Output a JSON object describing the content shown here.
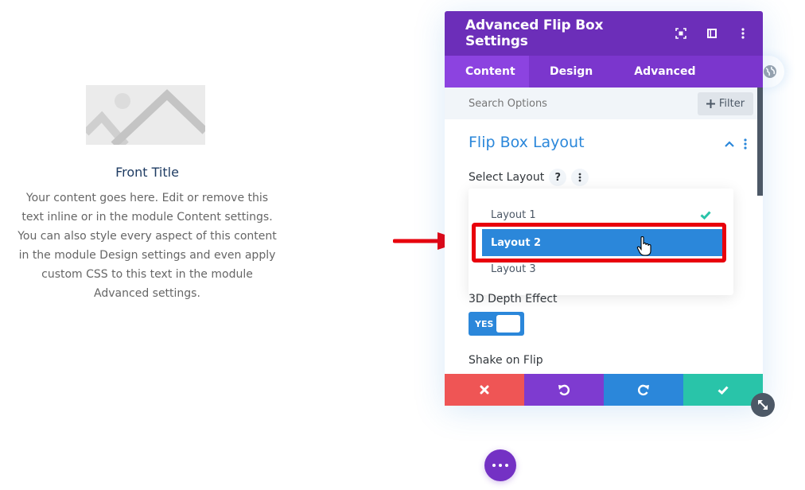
{
  "preview": {
    "image_icon": "image-placeholder-icon",
    "title": "Front Title",
    "body": "Your content goes here. Edit or remove this text inline or in the module Content settings. You can also style every aspect of this content in the module Design settings and even apply custom CSS to this text in the module Advanced settings."
  },
  "modal": {
    "title": "Advanced Flip Box Settings",
    "header_icons": [
      "fullscreen-icon",
      "sidebar-layout-icon",
      "more-vertical-icon"
    ],
    "tabs": [
      {
        "label": "Content",
        "active": true
      },
      {
        "label": "Design",
        "active": false
      },
      {
        "label": "Advanced",
        "active": false
      }
    ],
    "search": {
      "placeholder": "Search Options",
      "value": ""
    },
    "filter_label": "Filter",
    "section": {
      "title": "Flip Box Layout",
      "select_label": "Select Layout",
      "help_label": "?",
      "dropdown": {
        "options": [
          {
            "label": "Layout 1",
            "checked": true,
            "hovered": false
          },
          {
            "label": "Layout 2",
            "checked": false,
            "hovered": true
          },
          {
            "label": "Layout 3",
            "checked": false,
            "hovered": false
          }
        ]
      },
      "depth_label": "3D Depth Effect",
      "depth_toggle": {
        "label": "YES",
        "on": true
      },
      "shake_label": "Shake on Flip"
    },
    "footer": {
      "buttons": [
        {
          "name": "cancel",
          "icon": "close-icon",
          "color": "#ef5555"
        },
        {
          "name": "undo",
          "icon": "undo-icon",
          "color": "#7e3bd0"
        },
        {
          "name": "redo",
          "icon": "redo-icon",
          "color": "#2b87da"
        },
        {
          "name": "save",
          "icon": "check-icon",
          "color": "#29c4a9"
        }
      ]
    }
  },
  "colors": {
    "header": "#6c2eb9",
    "tabs": "#7b36cd",
    "active_tab": "#8c43e0",
    "accent_blue": "#2b87da",
    "highlight_red": "#e8000c",
    "check_green": "#29c4a9"
  }
}
